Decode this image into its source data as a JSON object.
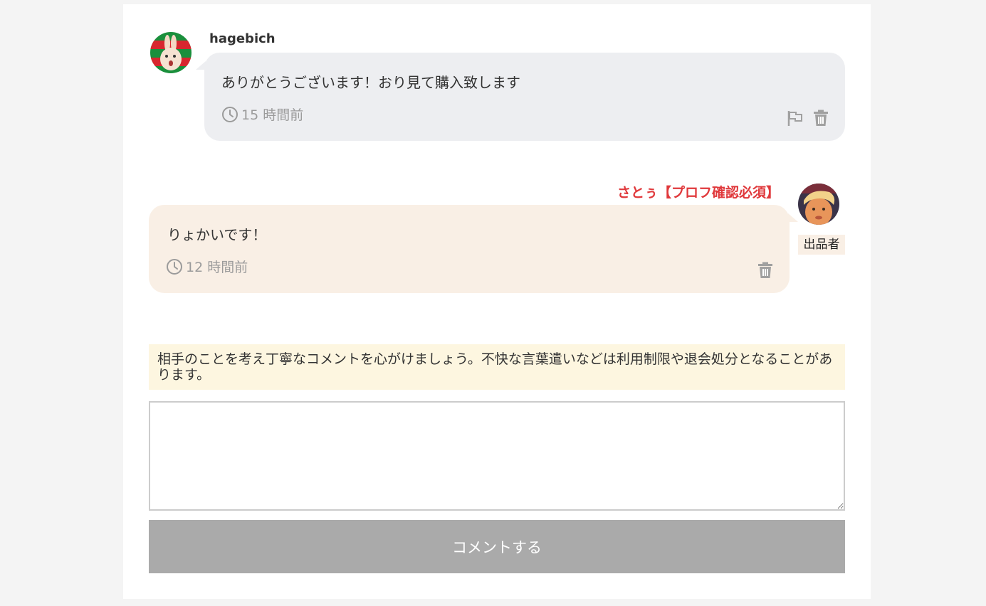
{
  "comments": [
    {
      "user": "hagebich",
      "message": "ありがとうございます！おり見て購入致します",
      "time": "15 時間前",
      "avatar_icon": "rabbit-avatar",
      "actions": [
        "flag-icon",
        "trash-icon"
      ]
    },
    {
      "user": "さとぅ【プロフ確認必須】",
      "badge": "出品者",
      "message": "りょかいです！",
      "time": "12 時間前",
      "avatar_icon": "person-avatar",
      "actions": [
        "trash-icon"
      ]
    }
  ],
  "form": {
    "notice": "相手のことを考え丁寧なコメントを心がけましょう。不快な言葉遣いなどは利用制限や退会処分となることがあります。",
    "textarea_placeholder": "",
    "submit_label": "コメントする"
  },
  "colors": {
    "buyer_bubble": "#edeef1",
    "seller_bubble": "#f9efe5",
    "seller_name": "#e0393c",
    "notice_bg": "#fdf6e0",
    "submit_bg": "#aaaaaa",
    "meta_gray": "#9b9b9b"
  }
}
